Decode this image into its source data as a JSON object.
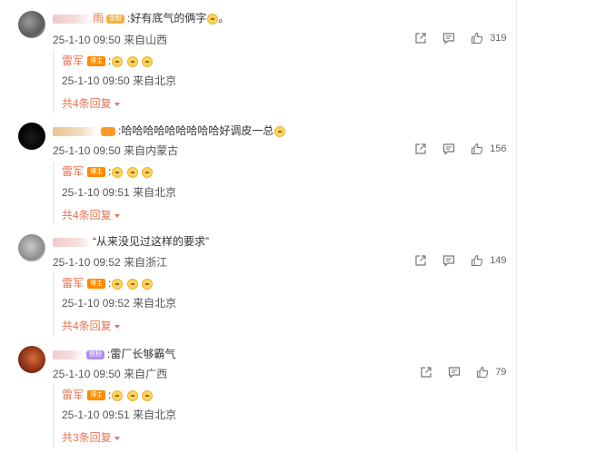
{
  "comments": [
    {
      "name_tail": "雨",
      "badge": "金粉",
      "text": ":好有底气的俩字",
      "time": "25-1-10 09:50",
      "location": "来自山西",
      "likes": "319",
      "reply": {
        "name": "雷军",
        "vip": "博主",
        "colon": ":",
        "time": "25-1-10 09:50",
        "location": "来自北京"
      },
      "more": "共4条回复"
    },
    {
      "name_tail": "",
      "badge": "",
      "text": ":哈哈哈哈哈哈哈哈哈好调皮一总",
      "time": "25-1-10 09:50",
      "location": "来自内蒙古",
      "likes": "156",
      "reply": {
        "name": "雷军",
        "vip": "博主",
        "colon": ":",
        "time": "25-1-10 09:51",
        "location": "来自北京"
      },
      "more": "共4条回复"
    },
    {
      "name_tail": "",
      "badge": "",
      "text": "“从来没见过这样的要求”",
      "time": "25-1-10 09:52",
      "location": "来自浙江",
      "likes": "149",
      "reply": {
        "name": "雷军",
        "vip": "博主",
        "colon": ":",
        "time": "25-1-10 09:52",
        "location": "来自北京"
      },
      "more": "共4条回复"
    },
    {
      "name_tail": "",
      "badge": "铁粉",
      "text": ":雷厂长够霸气",
      "time": "25-1-10 09:50",
      "location": "来自广西",
      "likes": "79",
      "reply": {
        "name": "雷军",
        "vip": "博主",
        "colon": ":",
        "time": "25-1-10 09:51",
        "location": "来自北京"
      },
      "more": "共3条回复"
    }
  ],
  "icons": {
    "share": "share-icon",
    "comment": "comment-icon",
    "like": "thumbs-up-icon",
    "emoji": "cat-face-emoji-icon"
  },
  "colors": {
    "name": "#eb7350",
    "text": "#333333",
    "meta": "#555555",
    "gold_badge": "#f5b33a",
    "purple_badge": "#b18cf0",
    "vip": "#ff8a00"
  }
}
